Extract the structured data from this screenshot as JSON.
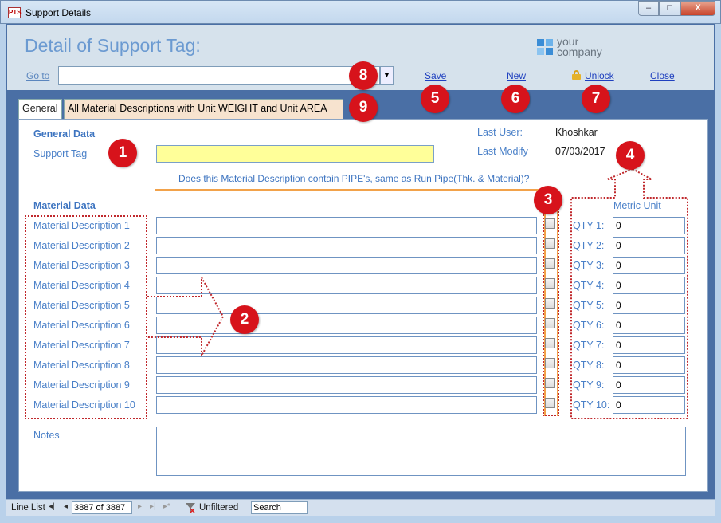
{
  "window": {
    "app_icon_text": "PTS",
    "title": "Support Details",
    "min_glyph": "–",
    "max_glyph": "□",
    "close_glyph": "X"
  },
  "header": {
    "title": "Detail of Support Tag:",
    "logo_line1": "your",
    "logo_line2": "company",
    "goto_label": "Go to",
    "goto_value": "",
    "save_label": "Save",
    "new_label": "New",
    "unlock_label": "Unlock",
    "close_label": "Close"
  },
  "tabs": [
    {
      "label": "General"
    },
    {
      "label": "All Material Descriptions with Unit WEIGHT and Unit AREA"
    }
  ],
  "general": {
    "section_title": "General Data",
    "support_tag_label": "Support Tag",
    "support_tag_value": "",
    "last_user_label": "Last User:",
    "last_user_value": "Khoshkar",
    "last_modify_label": "Last Modify",
    "last_modify_value": "07/03/2017",
    "pipe_question": "Does this Material Description contain PIPE's, same as Run Pipe(Thk. & Material)?"
  },
  "material": {
    "section_title": "Material Data",
    "unit_header": "Metric Unit",
    "rows": [
      {
        "label": "Material Description 1",
        "value": "",
        "qty_label": "QTY  1:",
        "qty": "0"
      },
      {
        "label": "Material Description 2",
        "value": "",
        "qty_label": "QTY  2:",
        "qty": "0"
      },
      {
        "label": "Material Description 3",
        "value": "",
        "qty_label": "QTY  3:",
        "qty": "0"
      },
      {
        "label": "Material Description 4",
        "value": "",
        "qty_label": "QTY  4:",
        "qty": "0"
      },
      {
        "label": "Material Description 5",
        "value": "",
        "qty_label": "QTY  5:",
        "qty": "0"
      },
      {
        "label": "Material Description 6",
        "value": "",
        "qty_label": "QTY  6:",
        "qty": "0"
      },
      {
        "label": "Material Description 7",
        "value": "",
        "qty_label": "QTY  7:",
        "qty": "0"
      },
      {
        "label": "Material Description 8",
        "value": "",
        "qty_label": "QTY  8:",
        "qty": "0"
      },
      {
        "label": "Material Description 9",
        "value": "",
        "qty_label": "QTY  9:",
        "qty": "0"
      },
      {
        "label": "Material Description 10",
        "value": "",
        "qty_label": "QTY 10:",
        "qty": "0"
      }
    ],
    "notes_label": "Notes"
  },
  "badges": [
    "1",
    "2",
    "3",
    "4",
    "5",
    "6",
    "7",
    "8",
    "9"
  ],
  "statusbar": {
    "label": "Line List",
    "first_glyph": "◂|",
    "prev_glyph": "◂",
    "record": "3887 of 3887",
    "next_glyph": "▸",
    "last_glyph": "▸|",
    "new_glyph": "▸*",
    "filter_label": "Unfiltered",
    "search_label": "Search"
  },
  "colors": {
    "accent": "#3d74c0",
    "badge": "#d7131b",
    "highlight_input": "#ffff99",
    "orange": "#f2a24a"
  }
}
